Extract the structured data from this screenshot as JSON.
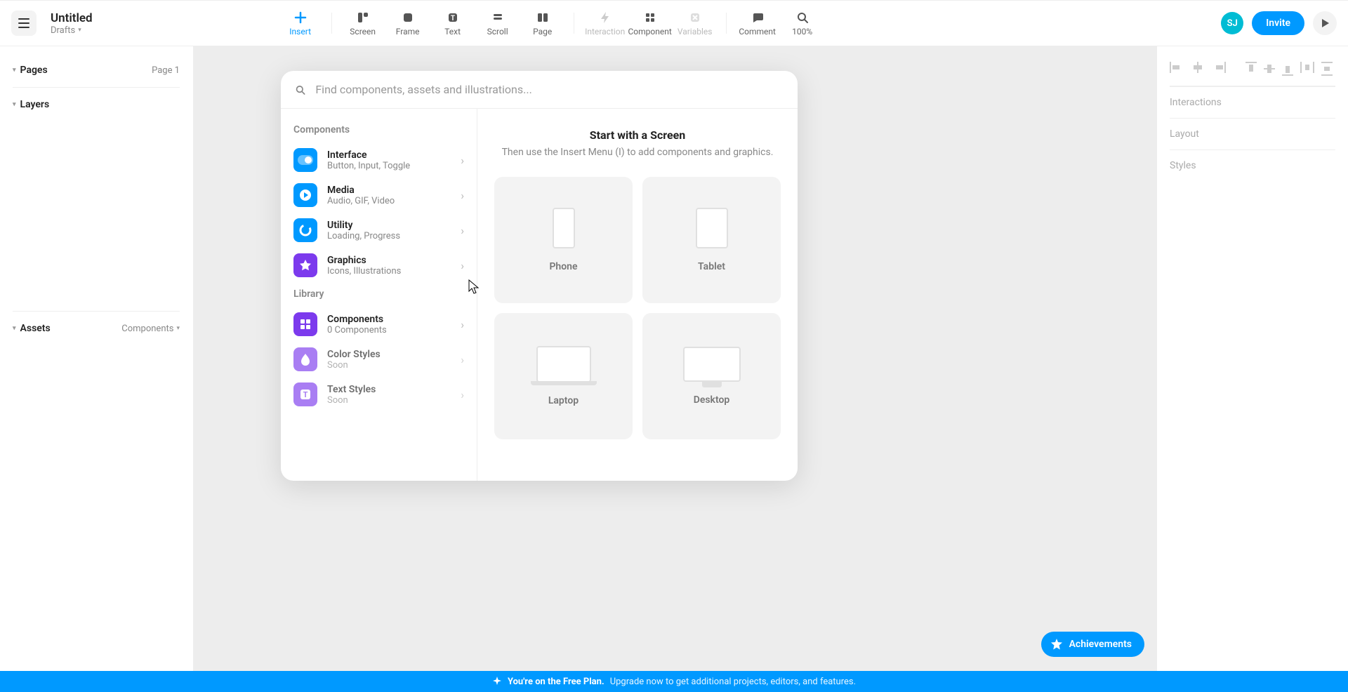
{
  "header": {
    "title": "Untitled",
    "location": "Drafts",
    "avatar": "SJ",
    "invite": "Invite",
    "zoom": "100%"
  },
  "toolbar": {
    "insert": "Insert",
    "screen": "Screen",
    "frame": "Frame",
    "text": "Text",
    "scroll": "Scroll",
    "page": "Page",
    "interaction": "Interaction",
    "component": "Component",
    "variables": "Variables",
    "comment": "Comment"
  },
  "left": {
    "pages": "Pages",
    "page_label": "Page 1",
    "layers": "Layers",
    "assets": "Assets",
    "assets_dd": "Components"
  },
  "right": {
    "interactions": "Interactions",
    "layout": "Layout",
    "styles": "Styles"
  },
  "popover": {
    "placeholder": "Find components, assets and illustrations...",
    "heading_components": "Components",
    "heading_library": "Library",
    "items": {
      "interface": {
        "title": "Interface",
        "sub": "Button, Input, Toggle"
      },
      "media": {
        "title": "Media",
        "sub": "Audio, GIF, Video"
      },
      "utility": {
        "title": "Utility",
        "sub": "Loading, Progress"
      },
      "graphics": {
        "title": "Graphics",
        "sub": "Icons, Illustrations"
      },
      "components": {
        "title": "Components",
        "sub": "0 Components"
      },
      "color_styles": {
        "title": "Color Styles",
        "sub": "Soon"
      },
      "text_styles": {
        "title": "Text Styles",
        "sub": "Soon"
      }
    },
    "start_title": "Start with a Screen",
    "start_sub": "Then use the Insert Menu (I) to add components and graphics.",
    "screens": {
      "phone": "Phone",
      "tablet": "Tablet",
      "laptop": "Laptop",
      "desktop": "Desktop"
    }
  },
  "achievements": "Achievements",
  "banner": {
    "strong": "You're on the Free Plan.",
    "rest": "Upgrade now to get additional projects, editors, and features."
  }
}
